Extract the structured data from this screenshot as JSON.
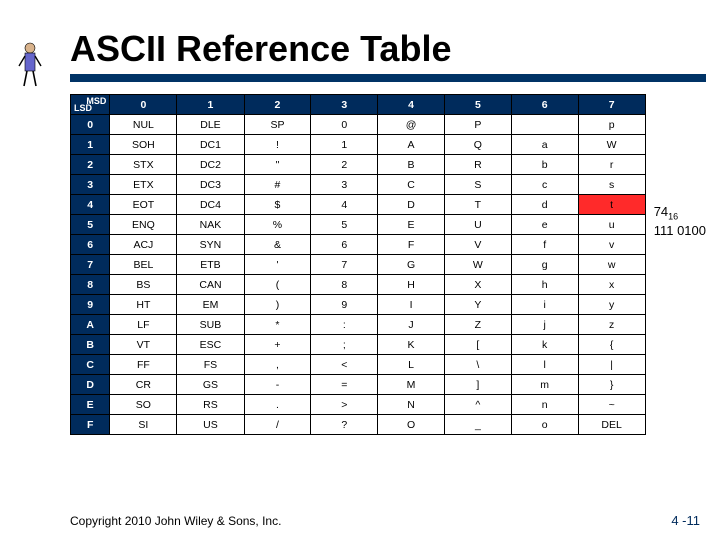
{
  "title": "ASCII Reference Table",
  "corner": {
    "msd": "MSD",
    "lsd": "LSD"
  },
  "col_headers": [
    "0",
    "1",
    "2",
    "3",
    "4",
    "5",
    "6",
    "7"
  ],
  "row_headers": [
    "0",
    "1",
    "2",
    "3",
    "4",
    "5",
    "6",
    "7",
    "8",
    "9",
    "A",
    "B",
    "C",
    "D",
    "E",
    "F"
  ],
  "grid": [
    [
      "NUL",
      "DLE",
      "SP",
      "0",
      "@",
      "P",
      "",
      "p"
    ],
    [
      "SOH",
      "DC1",
      "!",
      "1",
      "A",
      "Q",
      "a",
      "W"
    ],
    [
      "STX",
      "DC2",
      "\"",
      "2",
      "B",
      "R",
      "b",
      "r"
    ],
    [
      "ETX",
      "DC3",
      "#",
      "3",
      "C",
      "S",
      "c",
      "s"
    ],
    [
      "EOT",
      "DC4",
      "$",
      "4",
      "D",
      "T",
      "d",
      "t"
    ],
    [
      "ENQ",
      "NAK",
      "%",
      "5",
      "E",
      "U",
      "e",
      "u"
    ],
    [
      "ACJ",
      "SYN",
      "&",
      "6",
      "F",
      "V",
      "f",
      "v"
    ],
    [
      "BEL",
      "ETB",
      "'",
      "7",
      "G",
      "W",
      "g",
      "w"
    ],
    [
      "BS",
      "CAN",
      "(",
      "8",
      "H",
      "X",
      "h",
      "x"
    ],
    [
      "HT",
      "EM",
      ")",
      "9",
      "I",
      "Y",
      "i",
      "y"
    ],
    [
      "LF",
      "SUB",
      "*",
      ":",
      "J",
      "Z",
      "j",
      "z"
    ],
    [
      "VT",
      "ESC",
      "+",
      ";",
      "K",
      "[",
      "k",
      "{"
    ],
    [
      "FF",
      "FS",
      ",",
      "<",
      "L",
      "\\",
      "l",
      "|"
    ],
    [
      "CR",
      "GS",
      "-",
      "=",
      "M",
      "]",
      "m",
      "}"
    ],
    [
      "SO",
      "RS",
      ".",
      ">",
      "N",
      "^",
      "n",
      "~"
    ],
    [
      "SI",
      "US",
      "/",
      "?",
      "O",
      "_",
      "o",
      "DEL"
    ]
  ],
  "highlight": {
    "row": 4,
    "col": 7
  },
  "sidenote": {
    "hex": "74",
    "hexbase": "16",
    "bin": "111 0100"
  },
  "footer": {
    "left": "Copyright 2010 John Wiley & Sons, Inc.",
    "right": "4 -11"
  }
}
